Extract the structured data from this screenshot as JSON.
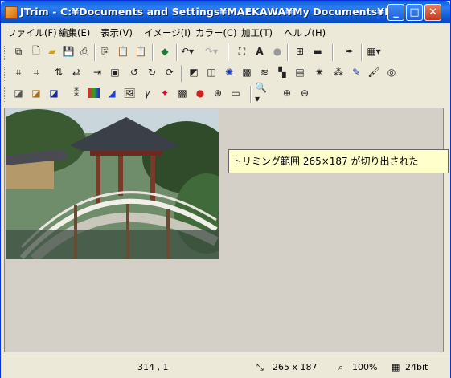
{
  "window": {
    "title": "JTrim - C:¥Documents and Settings¥MAEKAWA¥My Documents¥K..."
  },
  "menu": [
    {
      "label": "ファイル(F)"
    },
    {
      "label": "編集(E)"
    },
    {
      "label": "表示(V)"
    },
    {
      "label": "イメージ(I)"
    },
    {
      "label": "カラー(C)"
    },
    {
      "label": "加工(T)"
    },
    {
      "label": "ヘルプ(H)"
    }
  ],
  "callout": {
    "text": "トリミング範囲  265×187 が切り出された"
  },
  "status": {
    "coords": "314 , 1",
    "size": "265 x 187",
    "zoom": "100%",
    "bitdepth": "24bit"
  },
  "icons": {
    "title": [
      "app-icon",
      "minimize-icon",
      "maximize-icon",
      "close-icon"
    ],
    "toolbar1": [
      "capture-icon",
      "new-file-icon",
      "open-folder-icon",
      "save-icon",
      "print-icon",
      "copy-icon",
      "paste-icon",
      "paste-new-icon",
      "fill-icon",
      "undo-icon",
      "redo-icon",
      "fit-window-icon",
      "text-icon",
      "circle-icon",
      "grid-icon",
      "bar-icon",
      "eyedropper-icon",
      "palette-icon"
    ],
    "toolbar2": [
      "crop-icon",
      "trim-icon",
      "flip-vertical-icon",
      "flip-horizontal-icon",
      "resize-icon",
      "frame-icon",
      "rotate-90-left-icon",
      "rotate-90-right-icon",
      "rotate-icon",
      "shadow-icon",
      "shade-icon",
      "burst-icon",
      "halftone-icon",
      "wave-icon",
      "mosaic-icon",
      "brick-icon",
      "spark-icon",
      "noise-icon",
      "pencil-icon",
      "brush-icon",
      "spiral-icon"
    ],
    "toolbar3": [
      "grayscale-icon",
      "sepia-icon",
      "invert-icon",
      "sharpen-icon",
      "color-bars-icon",
      "gradient-icon",
      "image-icon",
      "gamma-icon",
      "color-balance-icon",
      "checker-icon",
      "rgb-icon",
      "xor-icon",
      "levels-icon",
      "zoom-menu-icon",
      "zoom-in-icon",
      "zoom-out-icon"
    ],
    "status": [
      "size-icon",
      "zoom-icon",
      "bitdepth-icon"
    ]
  },
  "colors": {
    "titlebar": "#0a5fd8",
    "workspace": "#d4d0c8",
    "callout_bg": "#ffffcc",
    "chrome": "#ece9d8"
  }
}
